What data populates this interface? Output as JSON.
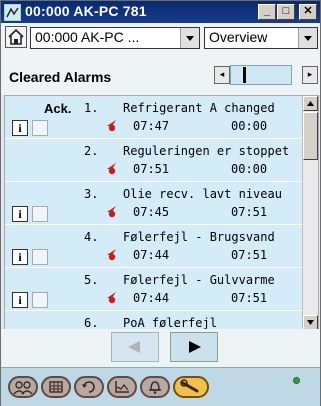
{
  "window": {
    "title": "00:000 AK-PC 781",
    "minimize": "_",
    "maximize": "□",
    "close": "✕"
  },
  "toolbar": {
    "device_select": "00:000 AK-PC ...",
    "view_select": "Overview"
  },
  "section": {
    "title": "Cleared Alarms"
  },
  "list": {
    "ack_header": "Ack.",
    "rows": [
      {
        "num": "1.",
        "text": "Refrigerant A changed",
        "time1": "07:47",
        "time2": "00:00",
        "has_info": true
      },
      {
        "num": "2.",
        "text": "Reguleringen er stoppet",
        "time1": "07:51",
        "time2": "00:00",
        "has_info": false
      },
      {
        "num": "3.",
        "text": "Olie recv. lavt niveau",
        "time1": "07:45",
        "time2": "07:51",
        "has_info": true
      },
      {
        "num": "4.",
        "text": "Følerfejl - Brugsvand",
        "time1": "07:44",
        "time2": "07:51",
        "has_info": true
      },
      {
        "num": "5.",
        "text": "Følerfejl - Gulvvarme",
        "time1": "07:44",
        "time2": "07:51",
        "has_info": true
      },
      {
        "num": "6.",
        "text": "PoA følerfejl",
        "time1": "",
        "time2": "",
        "has_info": false
      }
    ]
  },
  "nav": {
    "prev_icon": "left-arrow-icon",
    "next_icon": "right-arrow-icon"
  },
  "bottom_tabs": [
    {
      "icon": "people-icon"
    },
    {
      "icon": "table-icon"
    },
    {
      "icon": "refresh-icon"
    },
    {
      "icon": "graph-icon"
    },
    {
      "icon": "bell-icon"
    },
    {
      "icon": "wrench-icon",
      "active": true
    }
  ],
  "status": {
    "led_color": "#2ea040"
  }
}
